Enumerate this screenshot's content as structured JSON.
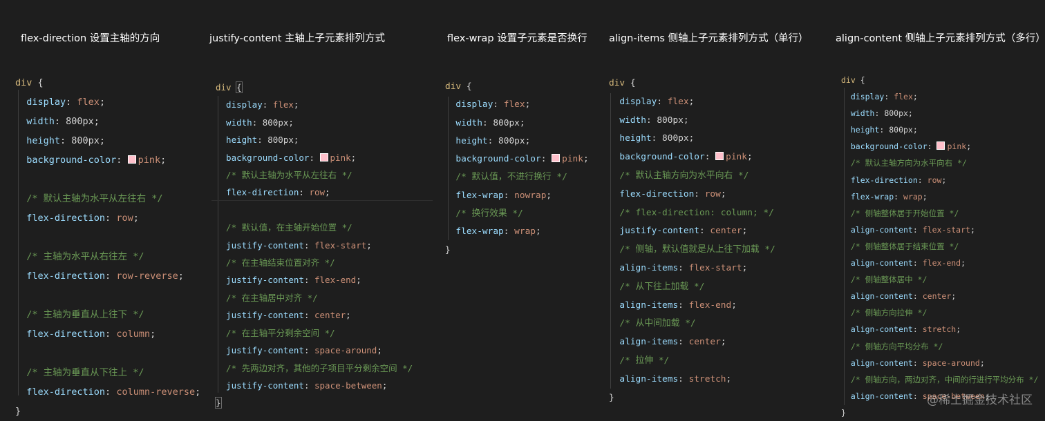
{
  "colors": {
    "background": "#1e1e1e",
    "selector": "#d7ba7d",
    "property": "#9cdcfe",
    "value": "#ce9178",
    "comment": "#6a9955",
    "punctuation": "#d4d4d4",
    "pink_swatch": "#ffc0cb"
  },
  "columns": [
    {
      "title": "flex-direction 设置主轴的方向",
      "lines": [
        [
          [
            "sel",
            "div"
          ],
          [
            "brace",
            " {"
          ]
        ],
        [
          [
            "prop",
            "display"
          ],
          [
            "punc",
            ": "
          ],
          [
            "val",
            "flex"
          ],
          [
            "punc",
            ";"
          ]
        ],
        [
          [
            "prop",
            "width"
          ],
          [
            "punc",
            ": 800px;"
          ]
        ],
        [
          [
            "prop",
            "height"
          ],
          [
            "punc",
            ": 800px;"
          ]
        ],
        [
          [
            "prop",
            "background-color"
          ],
          [
            "punc",
            ": "
          ],
          [
            "swatch",
            "pink"
          ],
          [
            "val",
            "pink"
          ],
          [
            "punc",
            ";"
          ]
        ],
        [],
        [
          [
            "cmt",
            "/* 默认主轴为水平从左往右 */"
          ]
        ],
        [
          [
            "prop",
            "flex-direction"
          ],
          [
            "punc",
            ": "
          ],
          [
            "val",
            "row"
          ],
          [
            "punc",
            ";"
          ]
        ],
        [],
        [
          [
            "cmt",
            "/* 主轴为水平从右往左 */"
          ]
        ],
        [
          [
            "prop",
            "flex-direction"
          ],
          [
            "punc",
            ": "
          ],
          [
            "val",
            "row-reverse"
          ],
          [
            "punc",
            ";"
          ]
        ],
        [],
        [
          [
            "cmt",
            "/* 主轴为垂直从上往下 */"
          ]
        ],
        [
          [
            "prop",
            "flex-direction"
          ],
          [
            "punc",
            ": "
          ],
          [
            "val",
            "column"
          ],
          [
            "punc",
            ";"
          ]
        ],
        [],
        [
          [
            "cmt",
            "/* 主轴为垂直从下往上 */"
          ]
        ],
        [
          [
            "prop",
            "flex-direction"
          ],
          [
            "punc",
            ": "
          ],
          [
            "val",
            "column-reverse"
          ],
          [
            "punc",
            ";"
          ]
        ],
        [
          [
            "brace",
            "}"
          ]
        ]
      ]
    },
    {
      "title": "justify-content 主轴上子元素排列方式",
      "lines": [
        [
          [
            "sel",
            "div"
          ],
          [
            "brace",
            " "
          ],
          [
            "bracebox",
            "{"
          ]
        ],
        [
          [
            "prop",
            "display"
          ],
          [
            "punc",
            ": "
          ],
          [
            "val",
            "flex"
          ],
          [
            "punc",
            ";"
          ]
        ],
        [
          [
            "prop",
            "width"
          ],
          [
            "punc",
            ": 800px;"
          ]
        ],
        [
          [
            "prop",
            "height"
          ],
          [
            "punc",
            ": 800px;"
          ]
        ],
        [
          [
            "prop",
            "background-color"
          ],
          [
            "punc",
            ": "
          ],
          [
            "swatch",
            "pink"
          ],
          [
            "val",
            "pink"
          ],
          [
            "punc",
            ";"
          ]
        ],
        [
          [
            "cmt",
            "/* 默认主轴为水平从左往右 */"
          ]
        ],
        [
          [
            "prop",
            "flex-direction"
          ],
          [
            "punc",
            ": "
          ],
          [
            "val",
            "row"
          ],
          [
            "punc",
            ";"
          ]
        ],
        [],
        [
          [
            "cmt",
            "/* 默认值，在主轴开始位置 */"
          ]
        ],
        [
          [
            "prop",
            "justify-content"
          ],
          [
            "punc",
            ": "
          ],
          [
            "val",
            "flex-start"
          ],
          [
            "punc",
            ";"
          ]
        ],
        [
          [
            "cmt",
            "/* 在主轴结束位置对齐 */"
          ]
        ],
        [
          [
            "prop",
            "justify-content"
          ],
          [
            "punc",
            ": "
          ],
          [
            "val",
            "flex-end"
          ],
          [
            "punc",
            ";"
          ]
        ],
        [
          [
            "cmt",
            "/* 在主轴居中对齐 */"
          ]
        ],
        [
          [
            "prop",
            "justify-content"
          ],
          [
            "punc",
            ": "
          ],
          [
            "val",
            "center"
          ],
          [
            "punc",
            ";"
          ]
        ],
        [
          [
            "cmt",
            "/* 在主轴平分剩余空间 */"
          ]
        ],
        [
          [
            "prop",
            "justify-content"
          ],
          [
            "punc",
            ": "
          ],
          [
            "val",
            "space-around"
          ],
          [
            "punc",
            ";"
          ]
        ],
        [
          [
            "cmt",
            "/* 先两边对齐，其他的子项目平分剩余空间 */"
          ]
        ],
        [
          [
            "prop",
            "justify-content"
          ],
          [
            "punc",
            ": "
          ],
          [
            "val",
            "space-between"
          ],
          [
            "punc",
            ";"
          ]
        ],
        [
          [
            "bracebox",
            "}"
          ]
        ]
      ]
    },
    {
      "title": "flex-wrap 设置子元素是否换行",
      "lines": [
        [
          [
            "sel",
            "div"
          ],
          [
            "brace",
            " {"
          ]
        ],
        [
          [
            "prop",
            "display"
          ],
          [
            "punc",
            ": "
          ],
          [
            "val",
            "flex"
          ],
          [
            "punc",
            ";"
          ]
        ],
        [
          [
            "prop",
            "width"
          ],
          [
            "punc",
            ": 800px;"
          ]
        ],
        [
          [
            "prop",
            "height"
          ],
          [
            "punc",
            ": 800px;"
          ]
        ],
        [
          [
            "prop",
            "background-color"
          ],
          [
            "punc",
            ": "
          ],
          [
            "swatch",
            "pink"
          ],
          [
            "val",
            "pink"
          ],
          [
            "punc",
            ";"
          ]
        ],
        [
          [
            "cmt",
            "/* 默认值，不进行换行 */"
          ]
        ],
        [
          [
            "prop",
            "flex-wrap"
          ],
          [
            "punc",
            ": "
          ],
          [
            "val",
            "nowrap"
          ],
          [
            "punc",
            ";"
          ]
        ],
        [
          [
            "cmt",
            "/* 换行效果 */"
          ]
        ],
        [
          [
            "prop",
            "flex-wrap"
          ],
          [
            "punc",
            ": "
          ],
          [
            "val",
            "wrap"
          ],
          [
            "punc",
            ";"
          ]
        ],
        [
          [
            "brace",
            "}"
          ]
        ]
      ]
    },
    {
      "title": "align-items 侧轴上子元素排列方式（单行）",
      "lines": [
        [
          [
            "sel",
            "div"
          ],
          [
            "brace",
            " {"
          ]
        ],
        [
          [
            "prop",
            "display"
          ],
          [
            "punc",
            ": "
          ],
          [
            "val",
            "flex"
          ],
          [
            "punc",
            ";"
          ]
        ],
        [
          [
            "prop",
            "width"
          ],
          [
            "punc",
            ": 800px;"
          ]
        ],
        [
          [
            "prop",
            "height"
          ],
          [
            "punc",
            ": 800px;"
          ]
        ],
        [
          [
            "prop",
            "background-color"
          ],
          [
            "punc",
            ": "
          ],
          [
            "swatch",
            "pink"
          ],
          [
            "val",
            "pink"
          ],
          [
            "punc",
            ";"
          ]
        ],
        [
          [
            "cmt",
            "/* 默认主轴方向为水平向右 */"
          ]
        ],
        [
          [
            "prop",
            "flex-direction"
          ],
          [
            "punc",
            ": "
          ],
          [
            "val",
            "row"
          ],
          [
            "punc",
            ";"
          ]
        ],
        [
          [
            "cmt",
            "/* flex-direction: column; */"
          ]
        ],
        [
          [
            "prop",
            "justify-content"
          ],
          [
            "punc",
            ": "
          ],
          [
            "val",
            "center"
          ],
          [
            "punc",
            ";"
          ]
        ],
        [
          [
            "cmt",
            "/* 侧轴，默认值就是从上往下加载 */"
          ]
        ],
        [
          [
            "prop",
            "align-items"
          ],
          [
            "punc",
            ": "
          ],
          [
            "val",
            "flex-start"
          ],
          [
            "punc",
            ";"
          ]
        ],
        [
          [
            "cmt",
            "/* 从下往上加载 */"
          ]
        ],
        [
          [
            "prop",
            "align-items"
          ],
          [
            "punc",
            ": "
          ],
          [
            "val",
            "flex-end"
          ],
          [
            "punc",
            ";"
          ]
        ],
        [
          [
            "cmt",
            "/* 从中间加载 */"
          ]
        ],
        [
          [
            "prop",
            "align-items"
          ],
          [
            "punc",
            ": "
          ],
          [
            "val",
            "center"
          ],
          [
            "punc",
            ";"
          ]
        ],
        [
          [
            "cmt",
            "/* 拉伸 */"
          ]
        ],
        [
          [
            "prop",
            "align-items"
          ],
          [
            "punc",
            ": "
          ],
          [
            "val",
            "stretch"
          ],
          [
            "punc",
            ";"
          ]
        ],
        [
          [
            "brace",
            "}"
          ]
        ]
      ]
    },
    {
      "title": "align-content 侧轴上子元素排列方式（多行）",
      "lines": [
        [
          [
            "sel",
            "div"
          ],
          [
            "brace",
            " {"
          ]
        ],
        [
          [
            "prop",
            "display"
          ],
          [
            "punc",
            ": "
          ],
          [
            "val",
            "flex"
          ],
          [
            "punc",
            ";"
          ]
        ],
        [
          [
            "prop",
            "width"
          ],
          [
            "punc",
            ": 800px;"
          ]
        ],
        [
          [
            "prop",
            "height"
          ],
          [
            "punc",
            ": 800px;"
          ]
        ],
        [
          [
            "prop",
            "background-color"
          ],
          [
            "punc",
            ": "
          ],
          [
            "swatch",
            "pink"
          ],
          [
            "val",
            "pink"
          ],
          [
            "punc",
            ";"
          ]
        ],
        [
          [
            "cmt",
            "/* 默认主轴方向为水平向右 */"
          ]
        ],
        [
          [
            "prop",
            "flex-direction"
          ],
          [
            "punc",
            ": "
          ],
          [
            "val",
            "row"
          ],
          [
            "punc",
            ";"
          ]
        ],
        [
          [
            "prop",
            "flex-wrap"
          ],
          [
            "punc",
            ": "
          ],
          [
            "val",
            "wrap"
          ],
          [
            "punc",
            ";"
          ]
        ],
        [
          [
            "cmt",
            "/* 侧轴整体居于开始位置 */"
          ]
        ],
        [
          [
            "prop",
            "align-content"
          ],
          [
            "punc",
            ": "
          ],
          [
            "val",
            "flex-start"
          ],
          [
            "punc",
            ";"
          ]
        ],
        [
          [
            "cmt",
            "/* 侧轴整体居于结束位置 */"
          ]
        ],
        [
          [
            "prop",
            "align-content"
          ],
          [
            "punc",
            ": "
          ],
          [
            "val",
            "flex-end"
          ],
          [
            "punc",
            ";"
          ]
        ],
        [
          [
            "cmt",
            "/* 侧轴整体居中 */"
          ]
        ],
        [
          [
            "prop",
            "align-content"
          ],
          [
            "punc",
            ": "
          ],
          [
            "val",
            "center"
          ],
          [
            "punc",
            ";"
          ]
        ],
        [
          [
            "cmt",
            "/* 侧轴方向拉伸 */"
          ]
        ],
        [
          [
            "prop",
            "align-content"
          ],
          [
            "punc",
            ": "
          ],
          [
            "val",
            "stretch"
          ],
          [
            "punc",
            ";"
          ]
        ],
        [
          [
            "cmt",
            "/* 侧轴方向平均分布 */"
          ]
        ],
        [
          [
            "prop",
            "align-content"
          ],
          [
            "punc",
            ": "
          ],
          [
            "val",
            "space-around"
          ],
          [
            "punc",
            ";"
          ]
        ],
        [
          [
            "cmt",
            "/* 侧轴方向，两边对齐，中间的行进行平均分布 */"
          ]
        ],
        [
          [
            "prop",
            "align-content"
          ],
          [
            "punc",
            ": "
          ],
          [
            "val",
            "space-between"
          ],
          [
            "punc",
            ";"
          ]
        ],
        [
          [
            "brace",
            "}"
          ]
        ]
      ]
    }
  ],
  "watermark": "@稀土掘金技术社区"
}
